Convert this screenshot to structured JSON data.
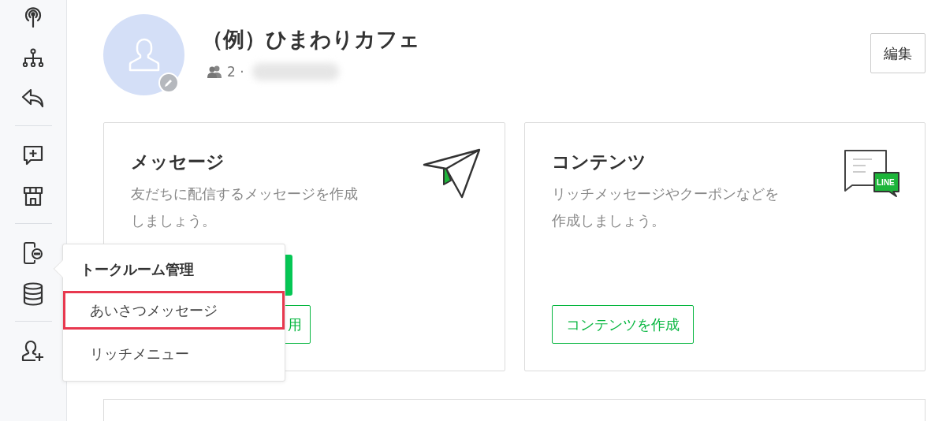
{
  "sidebar": {
    "groups": [
      {
        "items": [
          {
            "kind": "broadcast"
          },
          {
            "kind": "hierarchy"
          },
          {
            "kind": "reply"
          }
        ]
      },
      {
        "items": [
          {
            "kind": "chat-plus"
          },
          {
            "kind": "store"
          }
        ]
      },
      {
        "items": [
          {
            "kind": "phone-chat"
          },
          {
            "kind": "database"
          }
        ]
      },
      {
        "items": [
          {
            "kind": "add-user"
          }
        ]
      }
    ]
  },
  "account": {
    "name": "（例）ひまわりカフェ",
    "members": "2 ·",
    "edit_button": "編集"
  },
  "cards": [
    {
      "kind": "message",
      "title": "メッセージ",
      "description": "友だちに配信するメッセージを作成しましょう。",
      "buttons": [
        {
          "kind": "primary"
        },
        {
          "kind": "outline",
          "label": "用"
        }
      ]
    },
    {
      "kind": "content",
      "title": "コンテンツ",
      "description": "リッチメッセージやクーポンなどを作成しましょう。",
      "logo_label": "LINE",
      "buttons": [
        {
          "kind": "outline",
          "label": "コンテンツを作成"
        }
      ]
    }
  ],
  "popup": {
    "title": "トークルーム管理",
    "items": [
      {
        "label": "あいさつメッセージ",
        "highlighted": true
      },
      {
        "label": "リッチメニュー",
        "highlighted": false
      }
    ]
  }
}
